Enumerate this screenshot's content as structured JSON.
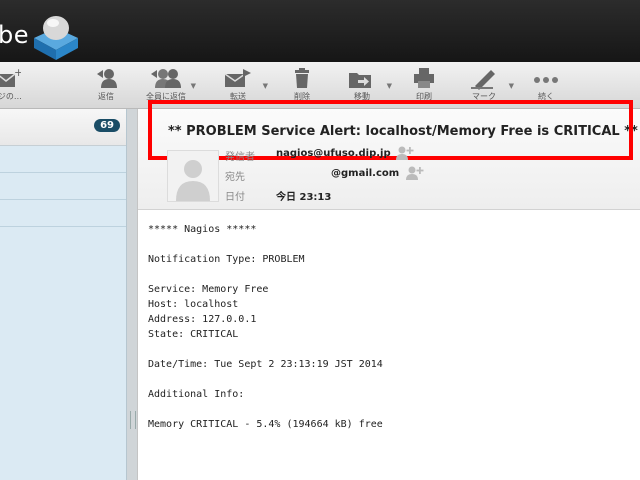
{
  "app": {
    "logo_text": "be"
  },
  "toolbar": {
    "items": [
      {
        "name": "compose",
        "label": "ージの…"
      },
      {
        "name": "reply",
        "label": "返信"
      },
      {
        "name": "reply-all",
        "label": "全員に返信"
      },
      {
        "name": "forward",
        "label": "転送"
      },
      {
        "name": "delete",
        "label": "削除"
      },
      {
        "name": "move",
        "label": "移動"
      },
      {
        "name": "print",
        "label": "印刷"
      },
      {
        "name": "mark",
        "label": "マーク"
      },
      {
        "name": "more",
        "label": "続く"
      }
    ]
  },
  "folders": {
    "unread_count": "69"
  },
  "message": {
    "subject": "** PROBLEM Service Alert: localhost/Memory Free is CRITICAL **",
    "from_label": "発信者",
    "from_value": "nagios@ufuso.dip.jp",
    "to_label": "宛先",
    "to_value": "@gmail.com",
    "date_label": "日付",
    "date_value": "今日 23:13",
    "body": "***** Nagios *****\n\nNotification Type: PROBLEM\n\nService: Memory Free\nHost: localhost\nAddress: 127.0.0.1\nState: CRITICAL\n\nDate/Time: Tue Sept 2 23:13:19 JST 2014\n\nAdditional Info:\n\nMemory CRITICAL - 5.4% (194664 kB) free"
  },
  "colors": {
    "highlight_box": "#ff0000",
    "badge": "#1a4d66",
    "sidebar": "#dbeaf3"
  }
}
